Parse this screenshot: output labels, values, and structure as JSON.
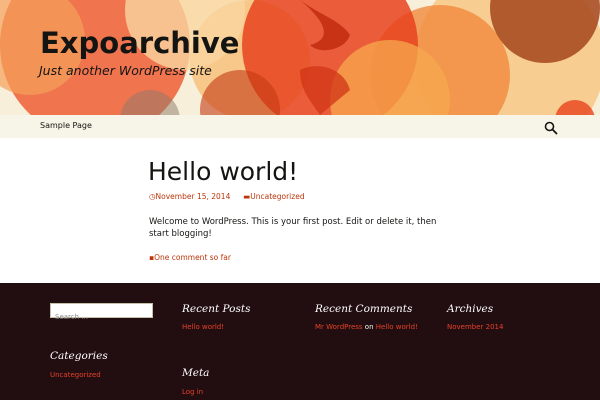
{
  "header": {
    "site_title": "Expoarchive",
    "site_description": "Just another WordPress site"
  },
  "nav": {
    "items": [
      {
        "label": "Sample Page"
      }
    ],
    "search_icon": "search-icon"
  },
  "post": {
    "title": "Hello world!",
    "date": "November 15, 2014",
    "category": "Uncategorized",
    "content": "Welcome to WordPress. This is your first post. Edit or delete it, then start blogging!",
    "comments_link": "One comment so far"
  },
  "footer": {
    "search_placeholder": "Search …",
    "recent_posts": {
      "title": "Recent Posts",
      "items": [
        "Hello world!"
      ]
    },
    "recent_comments": {
      "title": "Recent Comments",
      "author": "Mr WordPress",
      "on": "on",
      "post": "Hello world!"
    },
    "archives": {
      "title": "Archives",
      "items": [
        "November 2014"
      ]
    },
    "categories": {
      "title": "Categories",
      "items": [
        "Uncategorized"
      ]
    },
    "meta": {
      "title": "Meta",
      "items": [
        "Log in"
      ]
    }
  },
  "colors": {
    "accent": "#bc360a",
    "footer_bg": "#220e10",
    "footer_link": "#e6402a",
    "header_bg": "#f7efd9",
    "nav_bg": "#f7f5e7"
  }
}
